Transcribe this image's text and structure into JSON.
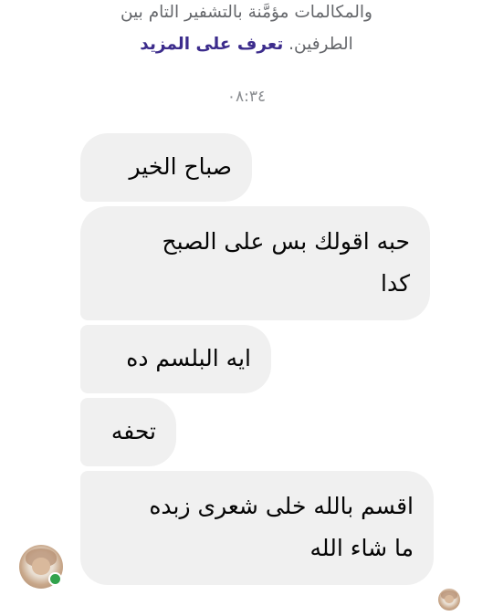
{
  "notice": {
    "line1": "والمكالمات مؤمَّنة بالتشفير التام بين",
    "line2_text": "الطرفين.",
    "learn_more": "تعرف على المزيد"
  },
  "timestamp": "٠٨:٣٤",
  "messages": [
    {
      "lines": [
        "صباح الخير"
      ]
    },
    {
      "lines": [
        "حبه اقولك بس على الصبح",
        "كدا"
      ]
    },
    {
      "lines": [
        "ايه البلسم ده"
      ]
    },
    {
      "lines": [
        "تحفه"
      ]
    },
    {
      "lines": [
        "اقسم بالله خلى شعرى زبده",
        "ما شاء الله"
      ]
    }
  ],
  "colors": {
    "bubble": "#f0f0f0",
    "link": "#3c2c8c",
    "online": "#31a24c"
  },
  "icons": {
    "sender_avatar": "profile-photo",
    "online_indicator": "green-dot",
    "seen_receipt": "profile-photo-small"
  }
}
